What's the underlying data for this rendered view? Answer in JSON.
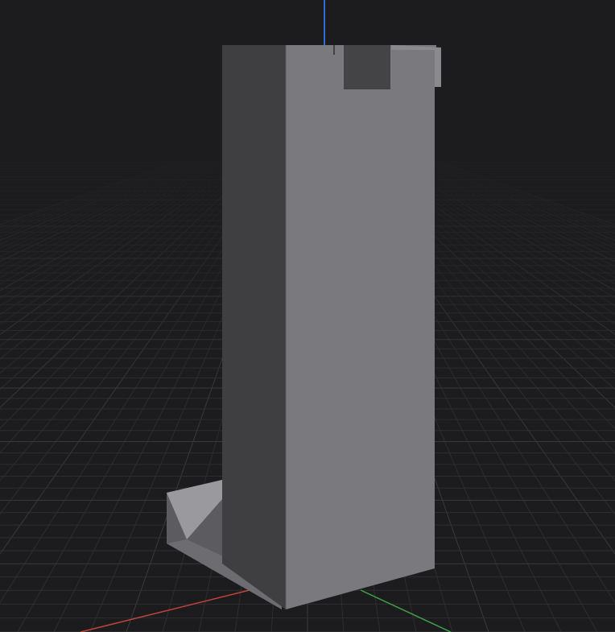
{
  "viewport": {
    "background": "#1c1c1e",
    "grid_color": "#3a3a3d",
    "grid_minor_color": "#2e2e31"
  },
  "axes": {
    "x_axis_color": "#c0433a",
    "y_axis_color": "#3fa34a",
    "z_axis_color": "#2d6fd6"
  },
  "model": {
    "front_face_color": "#7a7a7e",
    "left_face_color": "#3f3f42",
    "top_face_color": "#8a8a8e",
    "base_front_color": "#6d6d71",
    "base_left_color": "#5c5c60",
    "wedge_color": "#9a9a9e",
    "notch_color": "#444447"
  }
}
